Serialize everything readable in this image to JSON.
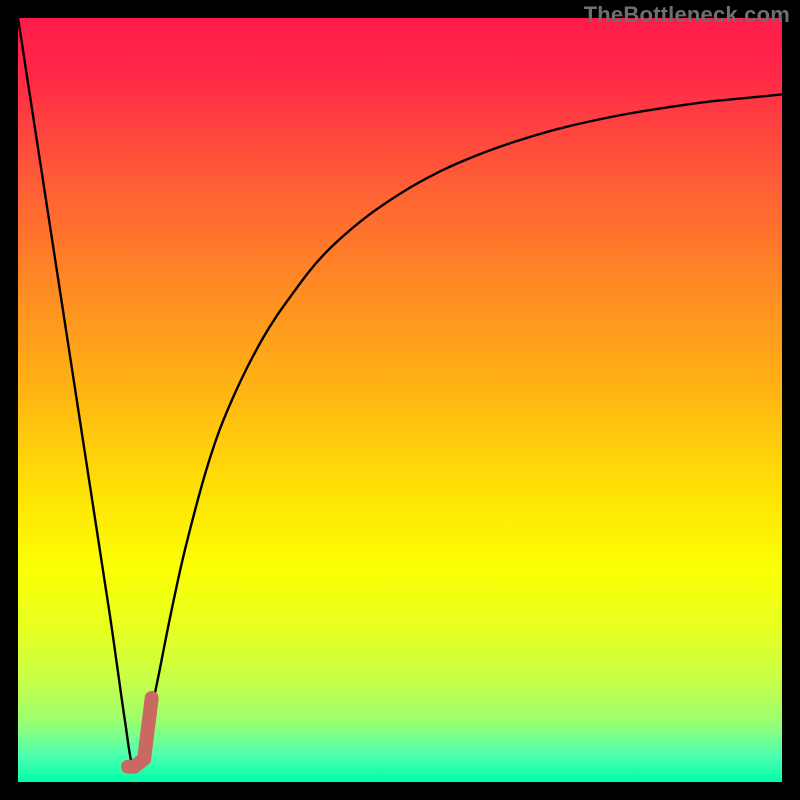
{
  "watermark": "TheBottleneck.com",
  "colors": {
    "frame": "#000000",
    "gradient_stops": [
      {
        "offset": 0.0,
        "color": "#ff1a4a"
      },
      {
        "offset": 0.08,
        "color": "#ff2a47"
      },
      {
        "offset": 0.2,
        "color": "#ff5838"
      },
      {
        "offset": 0.35,
        "color": "#ff8a24"
      },
      {
        "offset": 0.5,
        "color": "#ffb812"
      },
      {
        "offset": 0.62,
        "color": "#ffe205"
      },
      {
        "offset": 0.72,
        "color": "#fbff04"
      },
      {
        "offset": 0.8,
        "color": "#e6ff20"
      },
      {
        "offset": 0.87,
        "color": "#c6ff4a"
      },
      {
        "offset": 0.92,
        "color": "#9cff70"
      },
      {
        "offset": 0.965,
        "color": "#4dffb0"
      },
      {
        "offset": 1.0,
        "color": "#00ffa8"
      }
    ],
    "curve": "#000000",
    "marker": "#c96a62"
  },
  "chart_data": {
    "type": "line",
    "title": "",
    "xlabel": "",
    "ylabel": "",
    "xlim": [
      0,
      100
    ],
    "ylim": [
      0,
      100
    ],
    "series": [
      {
        "name": "bottleneck-curve",
        "x": [
          0,
          2,
          4,
          6,
          8,
          10,
          12,
          13,
          14,
          15,
          16,
          18,
          20,
          22,
          25,
          28,
          32,
          36,
          40,
          45,
          50,
          55,
          60,
          65,
          70,
          75,
          80,
          85,
          90,
          95,
          100
        ],
        "y": [
          100,
          87,
          74,
          61,
          48,
          35,
          22,
          15,
          8,
          2,
          3,
          12,
          22,
          31,
          42,
          50,
          58,
          64,
          69,
          73.5,
          77,
          79.8,
          82,
          83.8,
          85.3,
          86.5,
          87.5,
          88.3,
          89,
          89.5,
          90
        ]
      }
    ],
    "marker": {
      "name": "highlight-segment",
      "x": [
        14.4,
        15.2,
        16.5,
        17.5
      ],
      "y": [
        2,
        2,
        3,
        11
      ]
    },
    "optimum_x": 15
  }
}
